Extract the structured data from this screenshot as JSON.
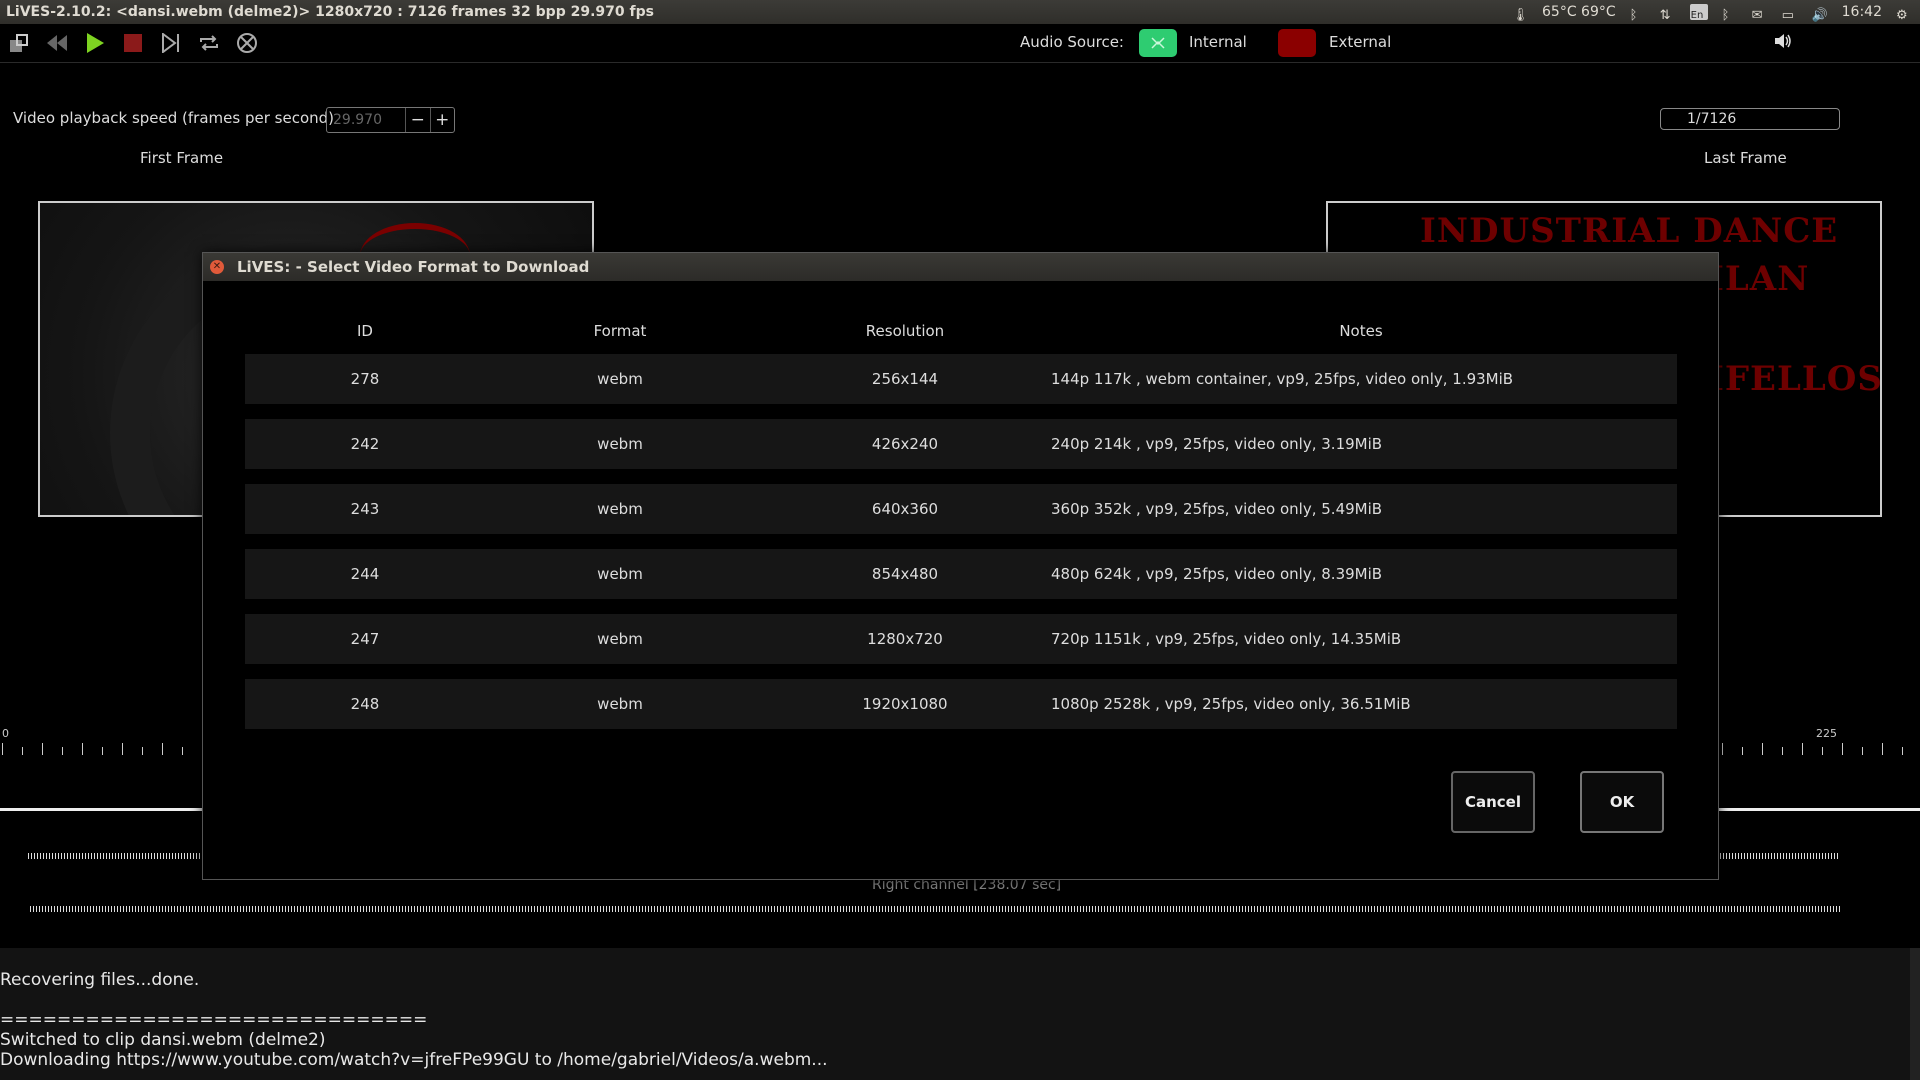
{
  "window": {
    "title": "LiVES-2.10.2: <dansi.webm (delme2)> 1280x720 : 7126 frames 32 bpp 29.970 fps"
  },
  "tray": {
    "temperature": "65°C 69°C",
    "keyboard": "En",
    "clock": "16:42"
  },
  "toolbar": {
    "audio_source_label": "Audio Source:",
    "internal_label": "Internal",
    "external_label": "External",
    "colors": {
      "internal": "#2ecc71",
      "external": "#8b0000"
    }
  },
  "playback": {
    "fps_label": "Video playback speed (frames per second)",
    "fps_value": "29.970",
    "minus": "−",
    "plus": "+",
    "frame_counter": "1/7126",
    "first_frame_label": "First Frame",
    "last_frame_label": "Last Frame"
  },
  "poster": {
    "line1": "INDUSTRIAL DANCE",
    "line2": "ILAN",
    "line3": "IFELLOS"
  },
  "timeline": {
    "start_label": "0",
    "end_label": "225",
    "right_channel_label": "Right channel [238.07 sec]"
  },
  "console": {
    "lines": [
      "Recovering files...done.",
      "",
      "==============================",
      "Switched to clip dansi.webm (delme2)",
      "Downloading https://www.youtube.com/watch?v=jfreFPe99GU to /home/gabriel/Videos/a.webm..."
    ]
  },
  "dialog": {
    "title": "LiVES: - Select Video Format to Download",
    "headers": {
      "id": "ID",
      "format": "Format",
      "resolution": "Resolution",
      "notes": "Notes"
    },
    "rows": [
      {
        "id": "278",
        "format": "webm",
        "resolution": "256x144",
        "notes": "144p  117k , webm container, vp9, 25fps, video only, 1.93MiB"
      },
      {
        "id": "242",
        "format": "webm",
        "resolution": "426x240",
        "notes": "240p  214k , vp9, 25fps, video only, 3.19MiB"
      },
      {
        "id": "243",
        "format": "webm",
        "resolution": "640x360",
        "notes": "360p  352k , vp9, 25fps, video only, 5.49MiB"
      },
      {
        "id": "244",
        "format": "webm",
        "resolution": "854x480",
        "notes": "480p  624k , vp9, 25fps, video only, 8.39MiB"
      },
      {
        "id": "247",
        "format": "webm",
        "resolution": "1280x720",
        "notes": "720p 1151k , vp9, 25fps, video only, 14.35MiB"
      },
      {
        "id": "248",
        "format": "webm",
        "resolution": "1920x1080",
        "notes": "1080p 2528k , vp9, 25fps, video only, 36.51MiB"
      }
    ],
    "cancel_label": "Cancel",
    "ok_label": "OK"
  }
}
